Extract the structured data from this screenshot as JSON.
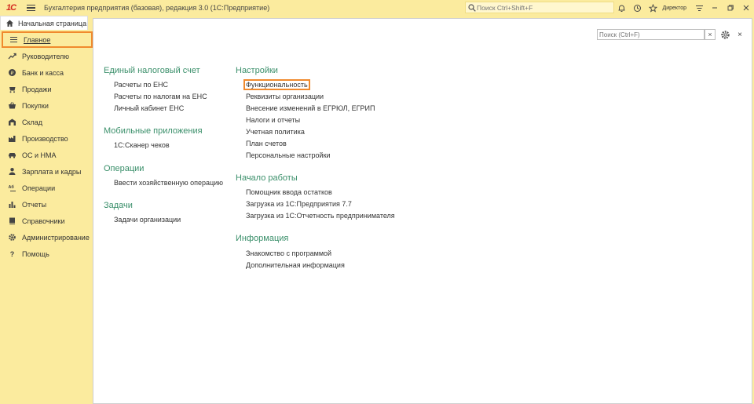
{
  "titlebar": {
    "logo": "1С",
    "title": "Бухгалтерия предприятия (базовая), редакция 3.0  (1С:Предприятие)",
    "search_placeholder": "Поиск Ctrl+Shift+F",
    "user": "Директор"
  },
  "home_tab": {
    "label": "Начальная страница"
  },
  "sidebar": {
    "items": [
      {
        "label": "Главное",
        "icon": "menu-lines-icon",
        "active": true
      },
      {
        "label": "Руководителю",
        "icon": "trend-icon"
      },
      {
        "label": "Банк и касса",
        "icon": "coin-icon"
      },
      {
        "label": "Продажи",
        "icon": "cart-icon"
      },
      {
        "label": "Покупки",
        "icon": "basket-icon"
      },
      {
        "label": "Склад",
        "icon": "warehouse-icon"
      },
      {
        "label": "Производство",
        "icon": "factory-icon"
      },
      {
        "label": "ОС и НМА",
        "icon": "car-icon"
      },
      {
        "label": "Зарплата и кадры",
        "icon": "person-icon"
      },
      {
        "label": "Операции",
        "icon": "operations-icon"
      },
      {
        "label": "Отчеты",
        "icon": "chart-icon"
      },
      {
        "label": "Справочники",
        "icon": "book-icon"
      },
      {
        "label": "Администрирование",
        "icon": "gear-icon"
      },
      {
        "label": "Помощь",
        "icon": "question-icon"
      }
    ]
  },
  "main": {
    "search_placeholder": "Поиск (Ctrl+F)",
    "clear": "×",
    "close": "×",
    "col1": {
      "ens": {
        "title": "Единый налоговый счет",
        "links": [
          "Расчеты по ЕНС",
          "Расчеты по налогам на ЕНС",
          "Личный кабинет ЕНС"
        ]
      },
      "mobile": {
        "title": "Мобильные приложения",
        "links": [
          "1С:Сканер чеков"
        ]
      },
      "ops": {
        "title": "Операции",
        "links": [
          "Ввести хозяйственную операцию"
        ]
      },
      "tasks": {
        "title": "Задачи",
        "links": [
          "Задачи организации"
        ]
      }
    },
    "col2": {
      "settings": {
        "title": "Настройки",
        "links": [
          "Функциональность",
          "Реквизиты организации",
          "Внесение изменений в ЕГРЮЛ, ЕГРИП",
          "Налоги и отчеты",
          "Учетная политика",
          "План счетов",
          "Персональные настройки"
        ]
      },
      "start": {
        "title": "Начало работы",
        "links": [
          "Помощник ввода остатков",
          "Загрузка из 1С:Предприятия 7.7",
          "Загрузка из 1С:Отчетность предпринимателя"
        ]
      },
      "info": {
        "title": "Информация",
        "links": [
          "Знакомство с программой",
          "Дополнительная информация"
        ]
      }
    }
  },
  "colors": {
    "sidebar_bg": "#fbeb9e",
    "section_title": "#3a8f6a",
    "highlight": "#f08a2d",
    "logo": "#d42a1f"
  }
}
